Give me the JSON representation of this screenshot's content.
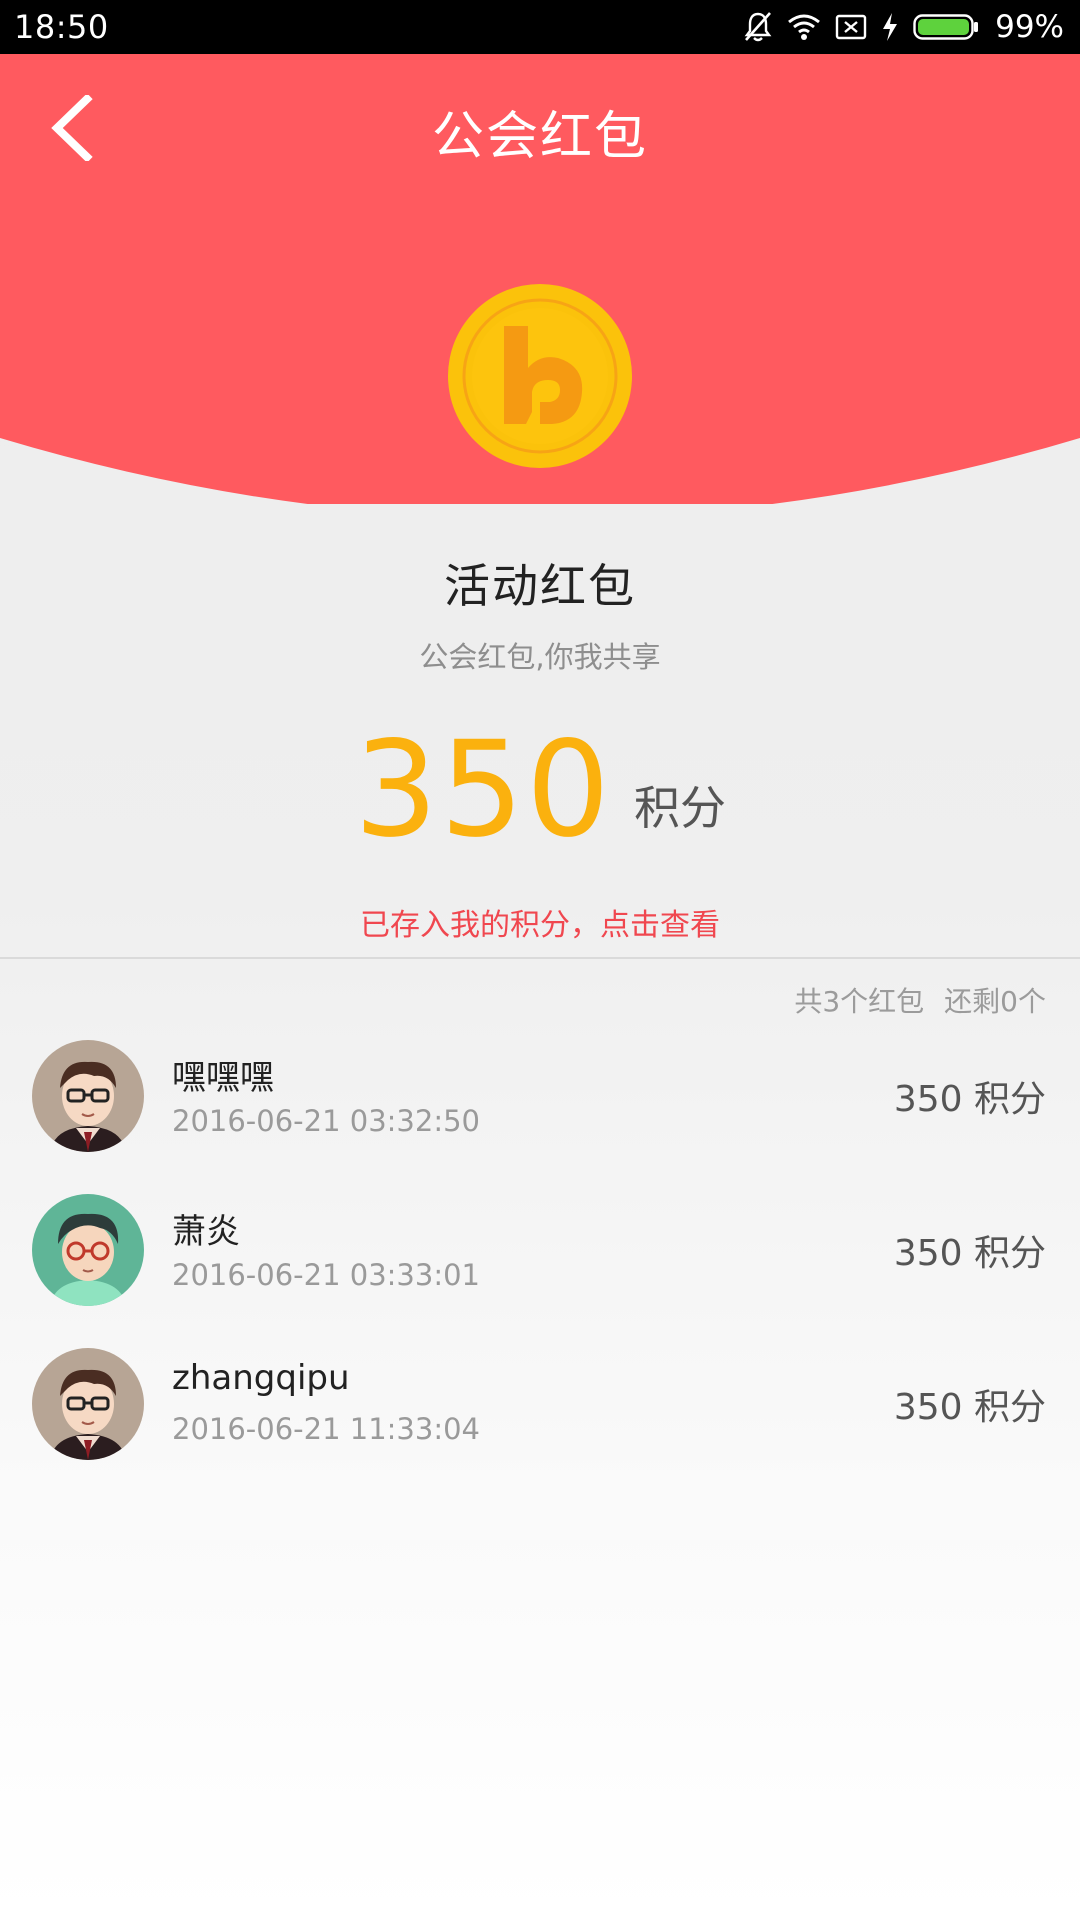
{
  "status_bar": {
    "time": "18:50",
    "battery_percent": "99%",
    "icons": [
      "bell-off-icon",
      "wifi-icon",
      "sim-off-icon",
      "charging-icon",
      "battery-icon"
    ]
  },
  "header": {
    "title": "公会红包",
    "back_icon": "chevron-left-icon",
    "background_color": "#ff5a5f"
  },
  "coin_icon": "coin-icon",
  "packet": {
    "title": "活动红包",
    "subtitle": "公会红包,你我共享",
    "amount": "350",
    "unit": "积分",
    "saved_link": "已存入我的积分，点击查看"
  },
  "summary": {
    "total": "共3个红包",
    "remaining": "还剩0个"
  },
  "records": [
    {
      "name": "嘿嘿嘿",
      "time": "2016-06-21 03:32:50",
      "amount": "350 积分",
      "avatar": "avatar-icon-brown"
    },
    {
      "name": "萧炎",
      "time": "2016-06-21 03:33:01",
      "amount": "350 积分",
      "avatar": "avatar-icon-green"
    },
    {
      "name": "zhangqipu",
      "time": "2016-06-21 11:33:04",
      "amount": "350 积分",
      "avatar": "avatar-icon-brown"
    }
  ],
  "colors": {
    "accent_red": "#ff5a5f",
    "amount_yellow": "#fbb10e",
    "link_red": "#f0474f"
  }
}
